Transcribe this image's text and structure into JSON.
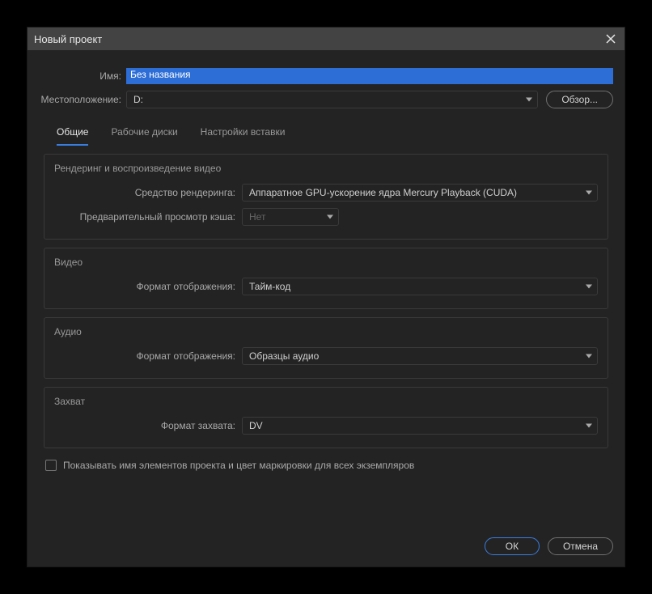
{
  "window": {
    "title": "Новый проект"
  },
  "fields": {
    "name_label": "Имя:",
    "name_value": "Без названия",
    "location_label": "Местоположение:",
    "location_value": "D:",
    "browse_label": "Обзор..."
  },
  "tabs": {
    "general": "Общие",
    "scratch": "Рабочие диски",
    "ingest": "Настройки вставки"
  },
  "rendering": {
    "group_title": "Рендеринг и воспроизведение видео",
    "renderer_label": "Средство рендеринга:",
    "renderer_value": "Аппаратное GPU-ускорение ядра Mercury Playback (CUDA)",
    "cache_label": "Предварительный просмотр кэша:",
    "cache_value": "Нет"
  },
  "video": {
    "group_title": "Видео",
    "format_label": "Формат отображения:",
    "format_value": "Тайм-код"
  },
  "audio": {
    "group_title": "Аудио",
    "format_label": "Формат отображения:",
    "format_value": "Образцы аудио"
  },
  "capture": {
    "group_title": "Захват",
    "format_label": "Формат захвата:",
    "format_value": "DV"
  },
  "checkbox": {
    "label": "Показывать имя элементов проекта и цвет маркировки для всех экземпляров"
  },
  "footer": {
    "ok": "ОК",
    "cancel": "Отмена"
  }
}
